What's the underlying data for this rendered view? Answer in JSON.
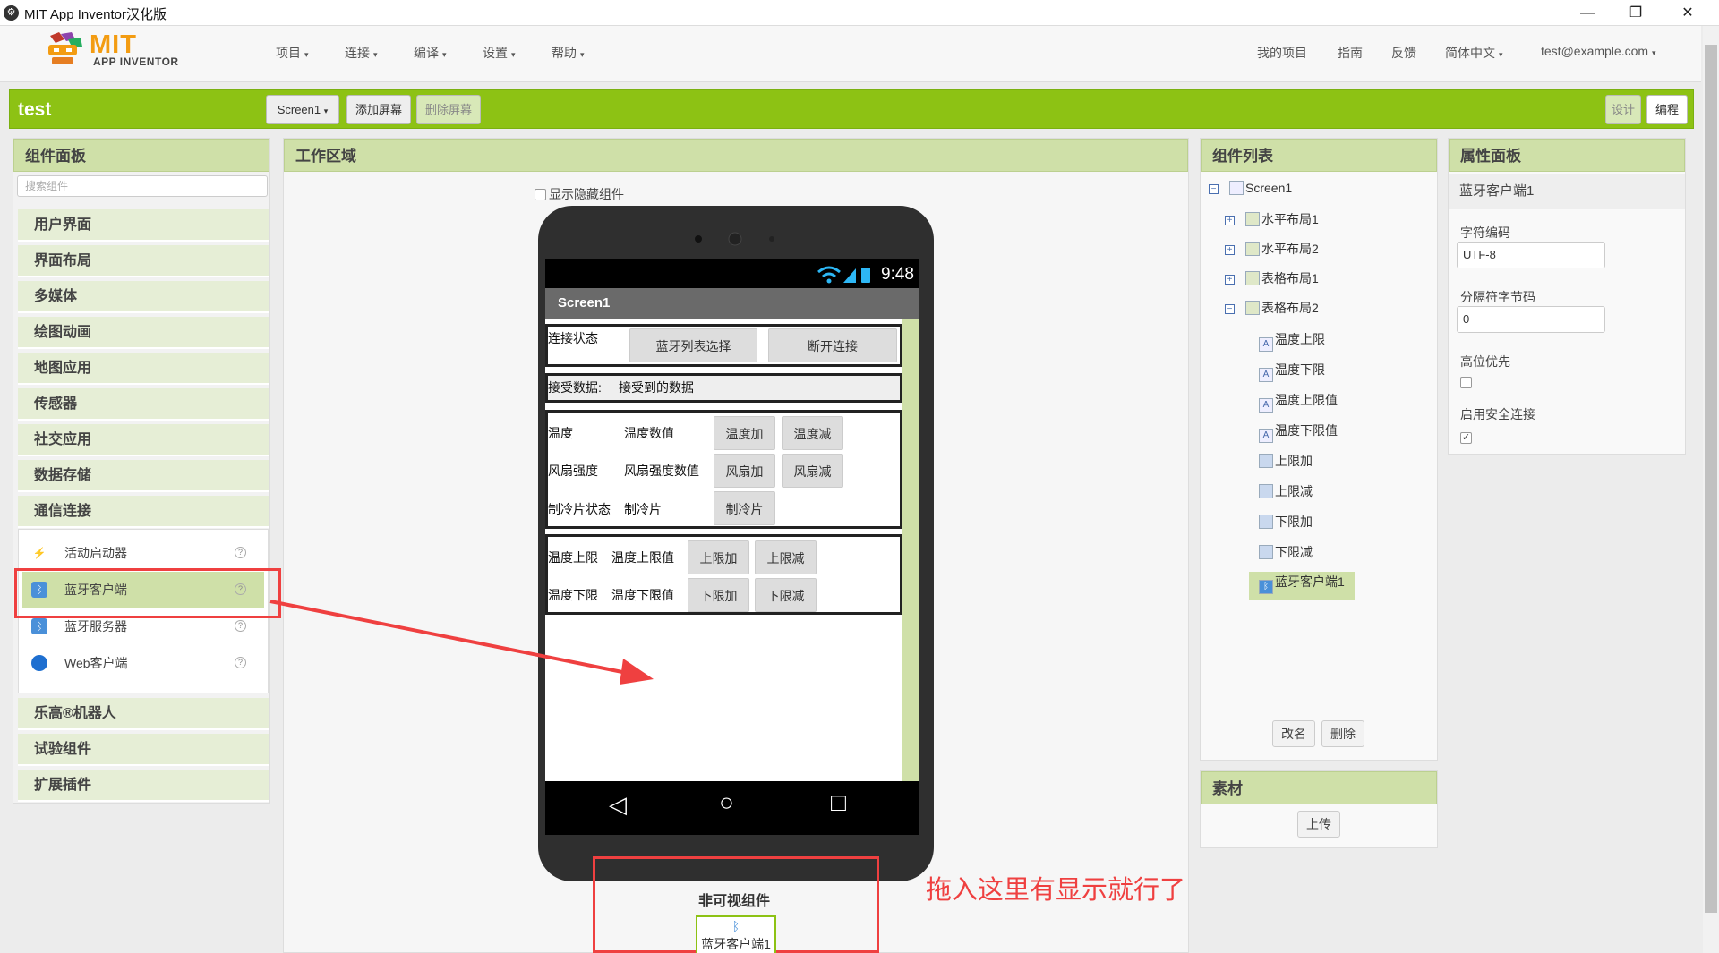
{
  "window": {
    "title": "MIT App Inventor汉化版",
    "minimize": "—",
    "maximize": "❐",
    "close": "✕"
  },
  "nav": {
    "logo_main": "MIT",
    "logo_sub": "APP INVENTOR",
    "left": [
      "项目",
      "连接",
      "编译",
      "设置",
      "帮助"
    ],
    "right": [
      "我的项目",
      "指南",
      "反馈",
      "简体中文"
    ],
    "user": "test@example.com",
    "caret": "▾"
  },
  "projectbar": {
    "title": "test",
    "screen_select": "Screen1",
    "add_screen": "添加屏幕",
    "remove_screen": "删除屏幕",
    "designer": "设计",
    "blocks": "编程"
  },
  "palette": {
    "title": "组件面板",
    "search_placeholder": "搜索组件",
    "categories_top": [
      "用户界面",
      "界面布局",
      "多媒体",
      "绘图动画",
      "地图应用",
      "传感器",
      "社交应用",
      "数据存储",
      "通信连接"
    ],
    "connectivity_items": [
      "活动启动器",
      "蓝牙客户端",
      "蓝牙服务器",
      "Web客户端"
    ],
    "help": "?",
    "categories_bottom": [
      "乐高®机器人",
      "试验组件",
      "扩展插件"
    ]
  },
  "viewer": {
    "title": "工作区域",
    "show_hidden": "显示隐藏组件",
    "clock": "9:48",
    "screen_title": "Screen1",
    "row1": {
      "label": "连接状态",
      "btn1": "蓝牙列表选择",
      "btn2": "断开连接"
    },
    "row2": {
      "label": "接受数据:",
      "value": "接受到的数据"
    },
    "table1": [
      {
        "a": "温度",
        "b": "温度数值",
        "c": "温度加",
        "d": "温度减"
      },
      {
        "a": "风扇强度",
        "b": "风扇强度数值",
        "c": "风扇加",
        "d": "风扇减"
      },
      {
        "a": "制冷片状态",
        "b": "制冷片",
        "c": "制冷片",
        "d": ""
      }
    ],
    "table2": [
      {
        "a": "温度上限",
        "b": "温度上限值",
        "c": "上限加",
        "d": "上限减"
      },
      {
        "a": "温度下限",
        "b": "温度下限值",
        "c": "下限加",
        "d": "下限减"
      }
    ],
    "nav_back": "◁",
    "nav_home": "○",
    "nav_recent": "□",
    "nonvisible_title": "非可视组件",
    "nonvisible_item": "蓝牙客户端1",
    "annotation": "拖入这里有显示就行了"
  },
  "components": {
    "title": "组件列表",
    "tree": [
      {
        "name": "Screen1",
        "level": 0,
        "toggle": "−"
      },
      {
        "name": "水平布局1",
        "level": 1,
        "toggle": "+"
      },
      {
        "name": "水平布局2",
        "level": 1,
        "toggle": "+"
      },
      {
        "name": "表格布局1",
        "level": 1,
        "toggle": "+"
      },
      {
        "name": "表格布局2",
        "level": 1,
        "toggle": "−"
      },
      {
        "name": "温度上限",
        "level": 2
      },
      {
        "name": "温度下限",
        "level": 2
      },
      {
        "name": "温度上限值",
        "level": 2
      },
      {
        "name": "温度下限值",
        "level": 2
      },
      {
        "name": "上限加",
        "level": 2
      },
      {
        "name": "上限减",
        "level": 2
      },
      {
        "name": "下限加",
        "level": 2
      },
      {
        "name": "下限减",
        "level": 2
      },
      {
        "name": "蓝牙客户端1",
        "level": 1
      }
    ],
    "rename": "改名",
    "delete": "删除",
    "media_title": "素材",
    "upload": "上传"
  },
  "properties": {
    "title": "属性面板",
    "component": "蓝牙客户端1",
    "char_encoding_label": "字符编码",
    "char_encoding_value": "UTF-8",
    "delimiter_label": "分隔符字节码",
    "delimiter_value": "0",
    "high_byte_first_label": "高位优先",
    "secure_label": "启用安全连接",
    "secure_checked": "✓"
  },
  "colors": {
    "accent_green": "#8dc214",
    "panel_green": "#cfe0a8",
    "annotation_red": "#ef4040"
  }
}
